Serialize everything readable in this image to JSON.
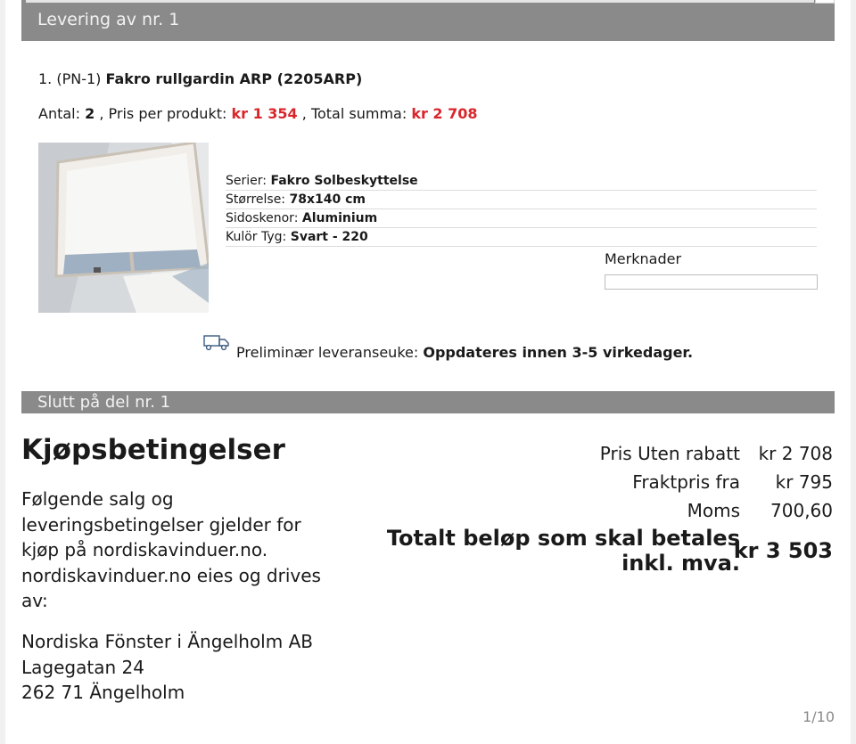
{
  "header_bar": {
    "label": "Levering av nr. 1"
  },
  "product": {
    "index": "1. (PN-1)",
    "name": "Fakro rullgardin ARP (2205ARP)",
    "qty_label": "Antal:",
    "qty": "2",
    "price_label": ", Pris per produkt:",
    "price": "kr 1 354",
    "total_label": ", Total summa:",
    "total": "kr 2 708",
    "specs": [
      {
        "label": "Serier:",
        "value": "Fakro Solbeskyttelse"
      },
      {
        "label": "Størrelse:",
        "value": "78x140 cm"
      },
      {
        "label": "Sidoskenor:",
        "value": "Aluminium"
      },
      {
        "label": "Kulör Tyg:",
        "value": "Svart - 220"
      }
    ],
    "notes_label": "Merknader",
    "delivery_label": "Preliminær leveranseuke:",
    "delivery_value": "Oppdateres innen 3-5 virkedager."
  },
  "end_bar": {
    "label": "Slutt på del nr. 1"
  },
  "terms": {
    "heading": "Kjøpsbetingelser",
    "text": "Følgende salg og leveringsbetingelser gjelder for kjøp på nordiskavinduer.no. nordiskavinduer.no eies og drives av:",
    "address": [
      "Nordiska Fönster i Ängelholm AB",
      "Lagegatan 24",
      "262 71 Ängelholm"
    ]
  },
  "summary": {
    "rows": [
      {
        "label": "Pris Uten rabatt",
        "value": "kr 2 708"
      },
      {
        "label": "Fraktpris fra",
        "value": "kr 795"
      },
      {
        "label": "Moms",
        "value": "700,60"
      }
    ],
    "total_label": "Totalt beløp som skal betales inkl. mva.",
    "total_value": "kr 3 503"
  },
  "pager": "1/10",
  "colors": {
    "bar": "#8a8a8a",
    "price_red": "#d9262b"
  },
  "icons": {
    "delivery": "truck-icon"
  }
}
